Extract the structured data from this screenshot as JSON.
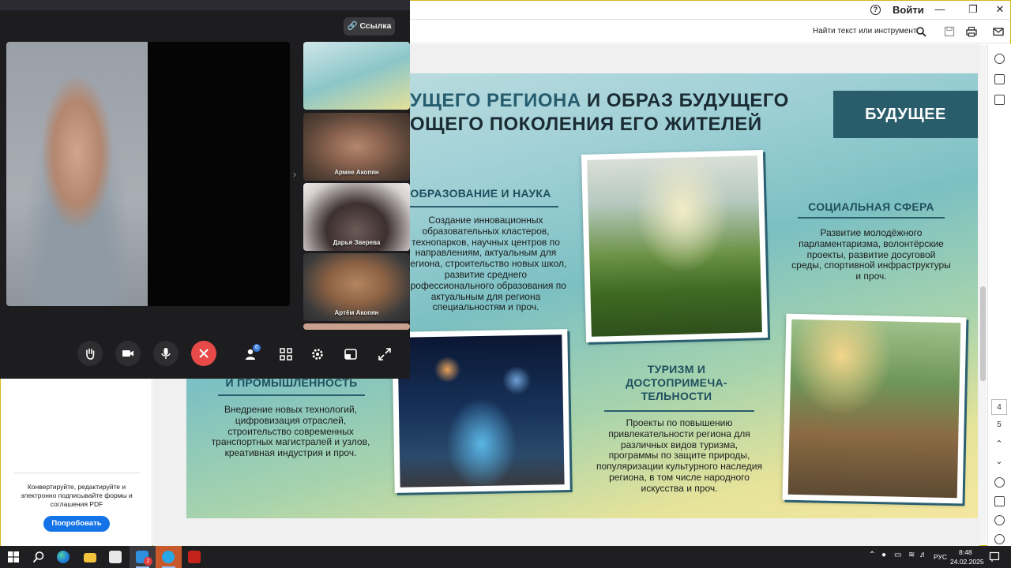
{
  "reader": {
    "sign_in": "Войти",
    "find_tool": "Найти текст или инструмент",
    "pages": [
      "4",
      "5"
    ],
    "promo_text": "Конвертируйте, редактируйте и электронно подписывайте формы и соглашения PDF",
    "try_button": "Попробовать"
  },
  "slide": {
    "title_line1_accent": "УЩЕГО РЕГИОНА",
    "title_line1_rest": " И ОБРАЗ БУДУЩЕГО",
    "title_line2": "ОЩЕГО ПОКОЛЕНИЯ ЕГО ЖИТЕЛЕЙ",
    "future_label": "БУДУЩЕЕ",
    "education": {
      "heading": "ОБРАЗОВАНИЕ И НАУКА",
      "body": "Создание инновационных образовательных кластеров, технопарков, научных центров по направлениям, актуальным для региона, строительство новых школ, развитие среднего профессионального образования по актуальным для региона специальностям и проч."
    },
    "social": {
      "heading": "СОЦИАЛЬНАЯ СФЕРА",
      "body": "Развитие молодёжного парламентаризма, волонтёрские проекты, развитие досуговой среды, спортивной инфраструктуры и проч."
    },
    "industry": {
      "heading": "И ПРОМЫШЛЕННОСТЬ",
      "body": "Внедрение новых технологий, цифровизация отраслей, строительство современных транспортных магистралей и узлов, креативная индустрия и проч."
    },
    "tourism": {
      "heading": "ТУРИЗМ И ДОСТОПРИМЕЧА- ТЕЛЬНОСТИ",
      "body": "Проекты по повышению привлекательности региона для различных видов туризма, программы по защите природы, популяризации культурного наследия региона, в том числе народного искусства и проч."
    }
  },
  "call": {
    "link_button": "Ссылка",
    "participants": [
      {
        "name": "Армее Акопян"
      },
      {
        "name": "Дарья Зверева"
      },
      {
        "name": "Артём Акопян"
      }
    ],
    "participants_badge": "6"
  },
  "taskbar": {
    "language": "РУС",
    "time": "8:48",
    "date": "24.02.2025",
    "telegram_badge": "2"
  },
  "colors": {
    "accent": "#2a5d6c",
    "end_call": "#e84a4a",
    "try_button": "#1473e6"
  }
}
